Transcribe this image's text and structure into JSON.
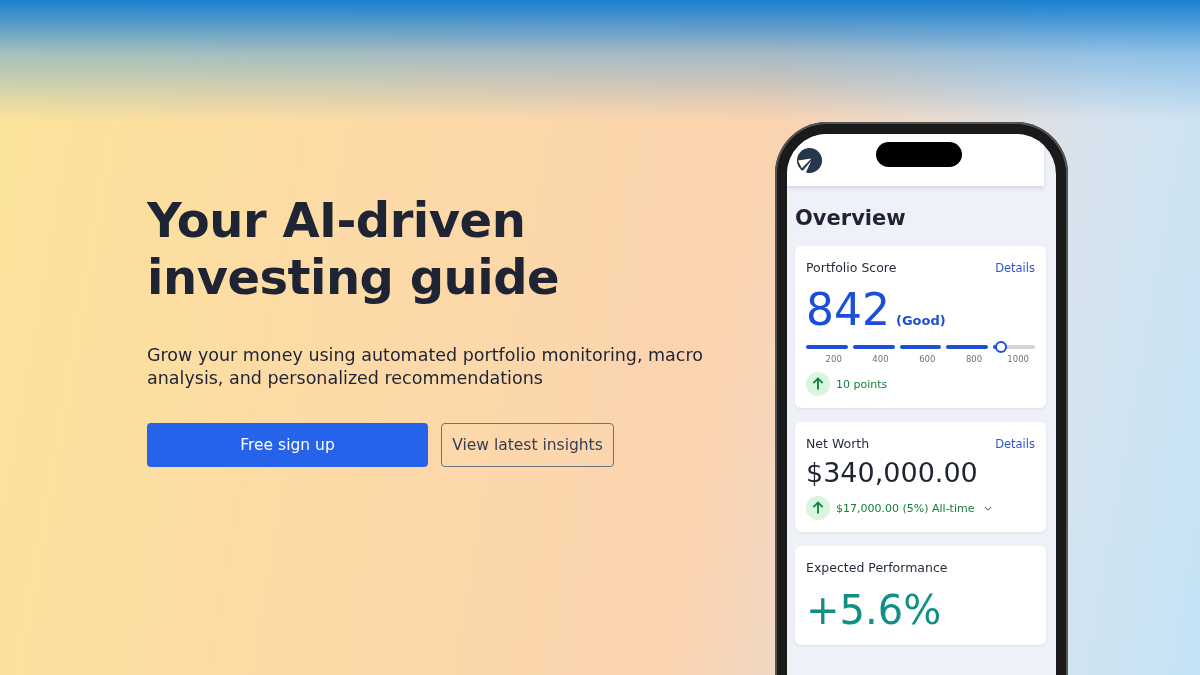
{
  "hero": {
    "heading_line1": "Your AI-driven",
    "heading_line2": "investing guide",
    "subtitle": "Grow your money using automated portfolio monitoring, macro analysis, and personalized recommendations",
    "primary_button": "Free sign up",
    "secondary_button": "View latest insights"
  },
  "phone": {
    "title": "Overview",
    "score_card": {
      "title": "Portfolio Score",
      "link": "Details",
      "score": "842",
      "rating": "(Good)",
      "level": 0.85,
      "ticks": [
        "200",
        "400",
        "600",
        "800",
        "1000"
      ],
      "change": "10 points"
    },
    "net_worth_card": {
      "title": "Net Worth",
      "link": "Details",
      "value": "$340,000.00",
      "change": "$17,000.00 (5%) All-time"
    },
    "performance_card": {
      "title": "Expected Performance",
      "value": "+5.6%"
    }
  }
}
